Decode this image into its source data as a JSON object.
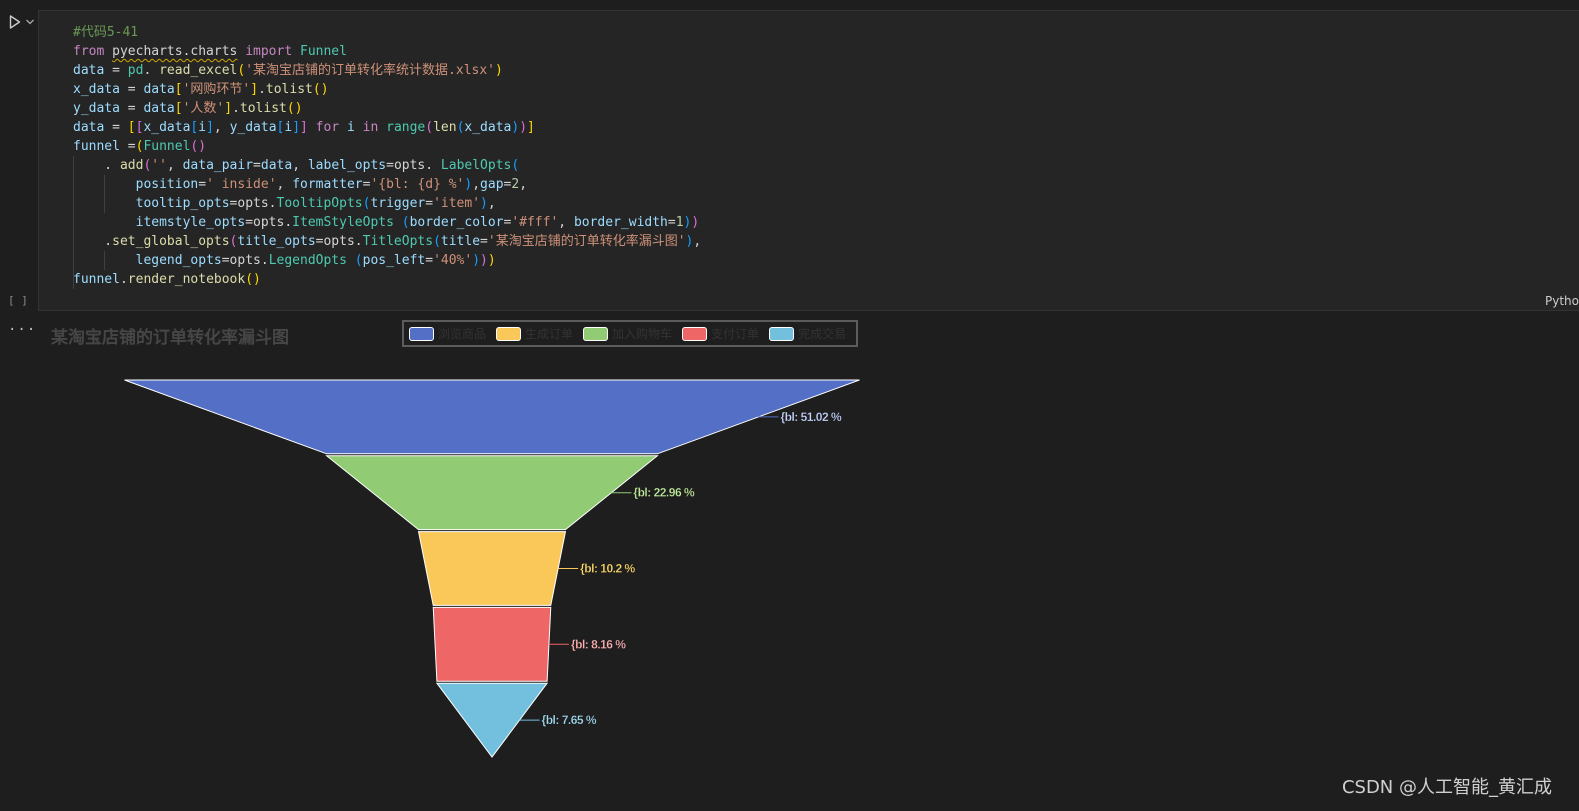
{
  "cell": {
    "execution_count": "[ ]",
    "language": "Pytho",
    "output_menu": "..."
  },
  "code": [
    [
      [
        "comment",
        "#代码5-41"
      ]
    ],
    [
      [
        "kw",
        "from"
      ],
      [
        "plain",
        " "
      ],
      [
        "plain_sq",
        "pyecharts.charts"
      ],
      [
        "plain",
        " "
      ],
      [
        "kw",
        "import"
      ],
      [
        "plain",
        " "
      ],
      [
        "cls",
        "Funnel"
      ]
    ],
    [
      [
        "var",
        "data"
      ],
      [
        "plain",
        " = "
      ],
      [
        "cls",
        "pd"
      ],
      [
        "plain",
        ". "
      ],
      [
        "fn",
        "read_excel"
      ],
      [
        "b1",
        "("
      ],
      [
        "str",
        "'某淘宝店铺的订单转化率统计数据.xlsx'"
      ],
      [
        "b1",
        ")"
      ]
    ],
    [
      [
        "var",
        "x_data"
      ],
      [
        "plain",
        " = "
      ],
      [
        "var",
        "data"
      ],
      [
        "b1",
        "["
      ],
      [
        "str",
        "'网购环节'"
      ],
      [
        "b1",
        "]"
      ],
      [
        "plain",
        "."
      ],
      [
        "fn",
        "tolist"
      ],
      [
        "b1",
        "()"
      ]
    ],
    [
      [
        "var",
        "y_data"
      ],
      [
        "plain",
        " = "
      ],
      [
        "var",
        "data"
      ],
      [
        "b1",
        "["
      ],
      [
        "str",
        "'人数'"
      ],
      [
        "b1",
        "]"
      ],
      [
        "plain",
        "."
      ],
      [
        "fn",
        "tolist"
      ],
      [
        "b1",
        "()"
      ]
    ],
    [
      [
        "var",
        "data"
      ],
      [
        "plain",
        " = "
      ],
      [
        "b1",
        "["
      ],
      [
        "b2",
        "["
      ],
      [
        "var",
        "x_data"
      ],
      [
        "b3",
        "["
      ],
      [
        "var",
        "i"
      ],
      [
        "b3",
        "]"
      ],
      [
        "plain",
        ", "
      ],
      [
        "var",
        "y_data"
      ],
      [
        "b3",
        "["
      ],
      [
        "var",
        "i"
      ],
      [
        "b3",
        "]"
      ],
      [
        "b2",
        "]"
      ],
      [
        "plain",
        " "
      ],
      [
        "kw",
        "for"
      ],
      [
        "plain",
        " "
      ],
      [
        "var",
        "i"
      ],
      [
        "plain",
        " "
      ],
      [
        "kw",
        "in"
      ],
      [
        "plain",
        " "
      ],
      [
        "cls",
        "range"
      ],
      [
        "b2",
        "("
      ],
      [
        "fn",
        "len"
      ],
      [
        "b3",
        "("
      ],
      [
        "var",
        "x_data"
      ],
      [
        "b3",
        ")"
      ],
      [
        "b2",
        ")"
      ],
      [
        "b1",
        "]"
      ]
    ],
    [
      [
        "var",
        "funnel"
      ],
      [
        "plain",
        " ="
      ],
      [
        "b1",
        "("
      ],
      [
        "cls",
        "Funnel"
      ],
      [
        "b2",
        "()"
      ]
    ],
    [
      [
        "plain",
        "    . "
      ],
      [
        "fn",
        "add"
      ],
      [
        "b2",
        "("
      ],
      [
        "str",
        "''"
      ],
      [
        "plain",
        ", "
      ],
      [
        "var",
        "data_pair"
      ],
      [
        "plain",
        "="
      ],
      [
        "var",
        "data"
      ],
      [
        "plain",
        ", "
      ],
      [
        "var",
        "label_opts"
      ],
      [
        "plain",
        "=opts. "
      ],
      [
        "cls",
        "LabelOpts"
      ],
      [
        "b3",
        "("
      ]
    ],
    [
      [
        "plain",
        "        "
      ],
      [
        "var",
        "position"
      ],
      [
        "plain",
        "="
      ],
      [
        "str",
        "' inside'"
      ],
      [
        "plain",
        ", "
      ],
      [
        "var",
        "formatter"
      ],
      [
        "plain",
        "="
      ],
      [
        "str",
        "'{bl: {d} %'"
      ],
      [
        "b3",
        ")"
      ],
      [
        "plain",
        ","
      ],
      [
        "var",
        "gap"
      ],
      [
        "plain",
        "="
      ],
      [
        "num",
        "2"
      ],
      [
        "plain",
        ","
      ]
    ],
    [
      [
        "plain",
        "        "
      ],
      [
        "var",
        "tooltip_opts"
      ],
      [
        "plain",
        "=opts."
      ],
      [
        "cls",
        "TooltipOpts"
      ],
      [
        "b3",
        "("
      ],
      [
        "var",
        "trigger"
      ],
      [
        "plain",
        "="
      ],
      [
        "str",
        "'item'"
      ],
      [
        "b3",
        ")"
      ],
      [
        "plain",
        ","
      ]
    ],
    [
      [
        "plain",
        "        "
      ],
      [
        "var",
        "itemstyle_opts"
      ],
      [
        "plain",
        "=opts."
      ],
      [
        "cls",
        "ItemStyleOpts"
      ],
      [
        "plain",
        " "
      ],
      [
        "b3",
        "("
      ],
      [
        "var",
        "border_color"
      ],
      [
        "plain",
        "="
      ],
      [
        "str",
        "'#fff'"
      ],
      [
        "plain",
        ", "
      ],
      [
        "var",
        "border_width"
      ],
      [
        "plain",
        "="
      ],
      [
        "num",
        "1"
      ],
      [
        "b3",
        ")"
      ],
      [
        "b2",
        ")"
      ]
    ],
    [
      [
        "plain",
        "    ."
      ],
      [
        "fn",
        "set_global_opts"
      ],
      [
        "b2",
        "("
      ],
      [
        "var",
        "title_opts"
      ],
      [
        "plain",
        "=opts."
      ],
      [
        "cls",
        "TitleOpts"
      ],
      [
        "b3",
        "("
      ],
      [
        "var",
        "title"
      ],
      [
        "plain",
        "="
      ],
      [
        "str",
        "'某淘宝店铺的订单转化率漏斗图'"
      ],
      [
        "b3",
        ")"
      ],
      [
        "plain",
        ","
      ]
    ],
    [
      [
        "plain",
        "        "
      ],
      [
        "var",
        "legend_opts"
      ],
      [
        "plain",
        "=opts."
      ],
      [
        "cls",
        "LegendOpts"
      ],
      [
        "plain",
        " "
      ],
      [
        "b3",
        "("
      ],
      [
        "var",
        "pos_left"
      ],
      [
        "plain",
        "="
      ],
      [
        "str",
        "'40%'"
      ],
      [
        "b3",
        ")"
      ],
      [
        "b2",
        ")"
      ],
      [
        "b1",
        ")"
      ]
    ],
    [
      [
        "var",
        "funnel"
      ],
      [
        "plain",
        "."
      ],
      [
        "fn",
        "render_notebook"
      ],
      [
        "b1",
        "()"
      ]
    ]
  ],
  "chart_data": {
    "type": "funnel",
    "title": "某淘宝店铺的订单转化率漏斗图",
    "legend_position": "top-center",
    "legend": [
      {
        "name": "浏览商品",
        "color": "#5470c6"
      },
      {
        "name": "生成订单",
        "color": "#fac858"
      },
      {
        "name": "加入购物车",
        "color": "#91cc75"
      },
      {
        "name": "支付订单",
        "color": "#ee6666"
      },
      {
        "name": "完成交易",
        "color": "#73c0de"
      }
    ],
    "slices": [
      {
        "name": "浏览商品",
        "percent": 51.02,
        "label": "{bl: 51.02 %",
        "color": "#5470c6",
        "label_color": "#c7d6ff"
      },
      {
        "name": "加入购物车",
        "percent": 22.96,
        "label": "{bl: 22.96 %",
        "color": "#91cc75",
        "label_color": "#c2ec9f"
      },
      {
        "name": "生成订单",
        "percent": 10.2,
        "label": "{bl: 10.2 %",
        "color": "#fac858",
        "label_color": "#fcd96a"
      },
      {
        "name": "支付订单",
        "percent": 8.16,
        "label": "{bl: 8.16 %",
        "color": "#ee6666",
        "label_color": "#ffb3b3"
      },
      {
        "name": "完成交易",
        "percent": 7.65,
        "label": "{bl: 7.65 %",
        "color": "#73c0de",
        "label_color": "#a3dcf2"
      }
    ]
  },
  "watermark": "CSDN @人工智能_黄汇成"
}
